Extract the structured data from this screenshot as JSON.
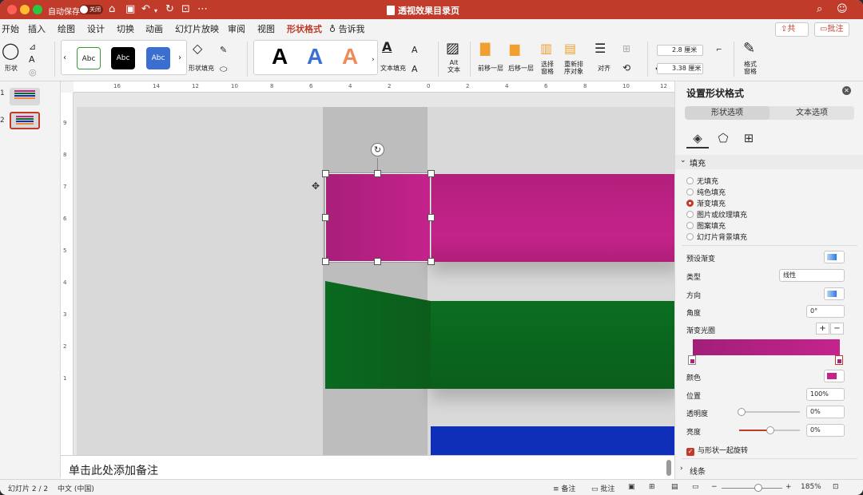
{
  "titlebar": {
    "autosave_label": "自动保存",
    "autosave_state": "关闭",
    "doc_title": "透视效果目录页"
  },
  "tabs": [
    "开始",
    "插入",
    "绘图",
    "设计",
    "切换",
    "动画",
    "幻灯片放映",
    "审阅",
    "视图",
    "形状格式",
    "告诉我"
  ],
  "active_tab": "形状格式",
  "header_buttons": {
    "share": "共享",
    "comment": "批注"
  },
  "ribbon": {
    "shape_label": "形状",
    "style_samples": [
      "Abc",
      "Abc",
      "Abc"
    ],
    "shape_fill_label": "形状填充",
    "wordart_samples": [
      "A",
      "A",
      "A"
    ],
    "text_fill_label": "文本填充",
    "alt_text_label": "Alt\n文本",
    "bring_forward": "前移一层",
    "send_backward": "后移一层",
    "selection_pane": "选择\n窗格",
    "reorder": "重新排\n序对象",
    "align": "对齐",
    "height": "2.8 厘米",
    "width": "3.38 厘米",
    "format_pane": "格式\n窗格"
  },
  "slides": [
    {
      "number": "1"
    },
    {
      "number": "2"
    }
  ],
  "ruler": {
    "h_ticks": [
      "16",
      "14",
      "12",
      "10",
      "8",
      "6",
      "4",
      "2",
      "0",
      "2",
      "4",
      "6",
      "8",
      "10",
      "12",
      "14"
    ],
    "v_ticks": [
      "9",
      "8",
      "7",
      "6",
      "5",
      "4",
      "3",
      "2",
      "1"
    ]
  },
  "notes_placeholder": "单击此处添加备注",
  "status": {
    "slide_info": "幻灯片 2 / 2",
    "language": "中文 (中国)",
    "notes_btn": "备注",
    "comments_btn": "批注",
    "zoom": "185%"
  },
  "format_pane": {
    "title": "设置形状格式",
    "tab_shape": "形状选项",
    "tab_text": "文本选项",
    "fill_section": "填充",
    "fill_options": [
      "无填充",
      "纯色填充",
      "渐变填充",
      "图片或纹理填充",
      "图案填充",
      "幻灯片背景填充"
    ],
    "selected_fill": "渐变填充",
    "preset_gradient_label": "预设渐变",
    "type_label": "类型",
    "type_value": "线性",
    "direction_label": "方向",
    "angle_label": "角度",
    "angle_value": "0°",
    "gradient_stops_label": "渐变光圈",
    "color_label": "颜色",
    "position_label": "位置",
    "position_value": "100%",
    "transparency_label": "透明度",
    "transparency_value": "0%",
    "brightness_label": "亮度",
    "brightness_value": "0%",
    "rotate_with_shape": "与形状一起旋转",
    "line_section": "线条"
  },
  "colors": {
    "accent": "#c13b2b",
    "pink": "#c4238a",
    "green": "#0b6e20",
    "blue": "#0f2fb8"
  },
  "icons": {
    "home": "home-icon",
    "save": "save-icon",
    "undo": "undo-icon",
    "redo": "redo-icon",
    "search": "search-icon",
    "smile": "feedback-icon"
  }
}
